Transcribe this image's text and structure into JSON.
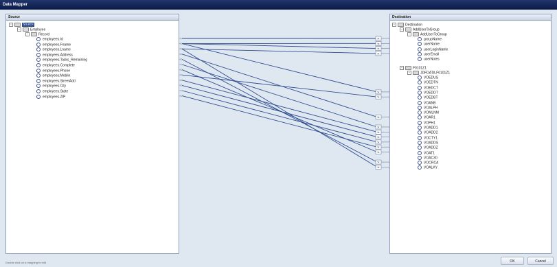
{
  "window": {
    "title": "Data Mapper"
  },
  "source": {
    "header": "Source",
    "root": "Source",
    "employee": "Employee",
    "record": "Record",
    "fields": [
      "employees.Id",
      "employees.Fname",
      "employees.Lname",
      "employees.Address",
      "employees.Tasks_Remaining",
      "employees.Complete",
      "employees.Phone",
      "employees.Mobile",
      "employees.StreetAdd",
      "employees.City",
      "employees.State",
      "employees.ZIP"
    ]
  },
  "destination": {
    "header": "Destination",
    "root": "Destination",
    "group1": "AddUserToGroup",
    "group1_child": "AddUserToGroup",
    "group1_fields": [
      "groupName",
      "userName",
      "userLoginName",
      "userEmail",
      "userNotes"
    ],
    "group2": "F0101Z1",
    "group2_child": "JDFDATA.F0101Z1",
    "group2_fields": [
      "VOEDUS",
      "VOEDTN",
      "VOEDCT",
      "VOEDDT",
      "VOEDBT",
      "VOANB",
      "VOALPH",
      "VOMLNM",
      "VOAR1",
      "VOPH1",
      "VOADD1",
      "VOADD2",
      "VOCTY1",
      "VOADDS",
      "VOADDZ",
      "VOAT1",
      "VOAC30",
      "VOCRCA",
      "VOALKY"
    ]
  },
  "mapping": {
    "function_label": "fx",
    "links": [
      {
        "from": 0,
        "to": 0
      },
      {
        "from": 1,
        "to": 1
      },
      {
        "from": 1,
        "to": 2
      },
      {
        "from": 2,
        "to": 3
      },
      {
        "from": 1,
        "to": 8
      },
      {
        "from": 3,
        "to": 13
      },
      {
        "from": 5,
        "to": 15
      },
      {
        "from": 6,
        "to": 20
      },
      {
        "from": 7,
        "to": 9
      },
      {
        "from": 8,
        "to": 16
      },
      {
        "from": 9,
        "to": 17
      },
      {
        "from": 10,
        "to": 18
      },
      {
        "from": 11,
        "to": 19
      },
      {
        "from": 4,
        "to": 22
      },
      {
        "from": 2,
        "to": 23
      }
    ]
  },
  "buttons": {
    "ok": "OK",
    "cancel": "Cancel"
  },
  "status": "Double click on a mapping to edit"
}
